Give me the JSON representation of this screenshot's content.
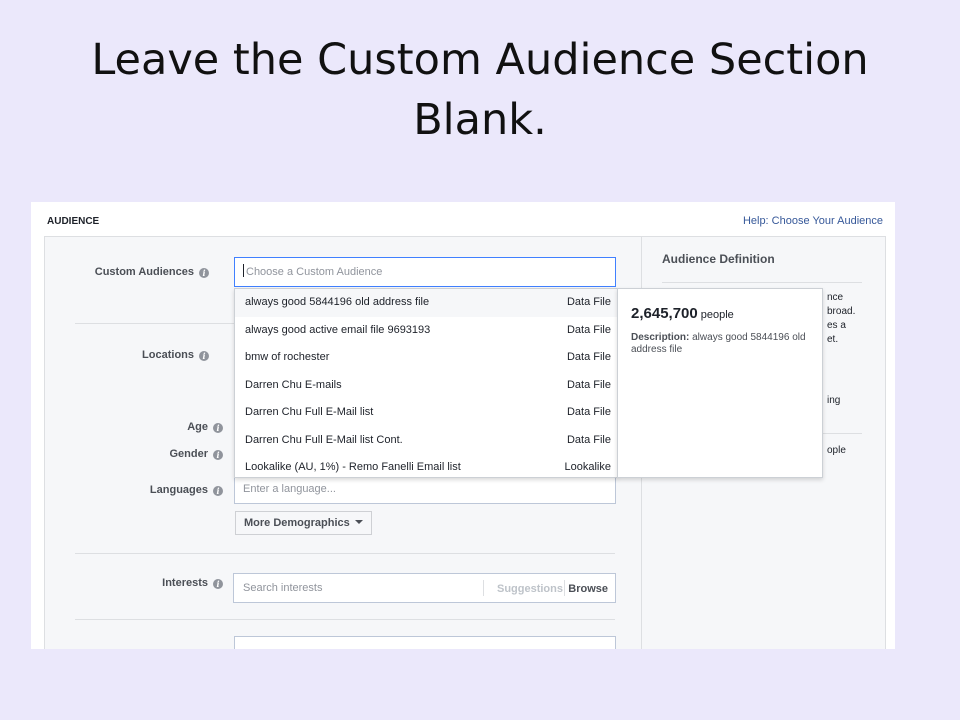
{
  "slide": {
    "title_line1": "Leave the Custom Audience Section",
    "title_line2": "Blank."
  },
  "audience": {
    "header": "AUDIENCE",
    "help_link": "Help: Choose Your Audience"
  },
  "fields": {
    "custom_audiences_label": "Custom Audiences",
    "custom_audiences_placeholder": "Choose a Custom Audience",
    "locations_label": "Locations",
    "age_label": "Age",
    "gender_label": "Gender",
    "languages_label": "Languages",
    "languages_placeholder": "Enter a language...",
    "more_demographics": "More Demographics",
    "interests_label": "Interests",
    "interests_placeholder": "Search interests",
    "suggestions": "Suggestions",
    "browse": "Browse"
  },
  "dropdown": {
    "items": [
      {
        "name": "always good 5844196 old address file",
        "type": "Data File"
      },
      {
        "name": "always good active email file 9693193",
        "type": "Data File"
      },
      {
        "name": "bmw of rochester",
        "type": "Data File"
      },
      {
        "name": "Darren Chu E-mails",
        "type": "Data File"
      },
      {
        "name": "Darren Chu Full E-Mail list",
        "type": "Data File"
      },
      {
        "name": "Darren Chu Full E-Mail list Cont.",
        "type": "Data File"
      },
      {
        "name": "Lookalike (AU, 1%) - Remo Fanelli Email list",
        "type": "Lookalike"
      }
    ]
  },
  "tooltip": {
    "size": "2,645,700",
    "unit": "people",
    "desc_label": "Description:",
    "desc_text": "always good 5844196 old address file"
  },
  "definition": {
    "title": "Audience Definition",
    "fragments": [
      "nce",
      "broad.",
      "es a",
      "et.",
      "ing",
      "ople"
    ]
  },
  "colors": {
    "slide_bg": "#ebe8fb",
    "link": "#365899",
    "focus_border": "#4080ff"
  }
}
